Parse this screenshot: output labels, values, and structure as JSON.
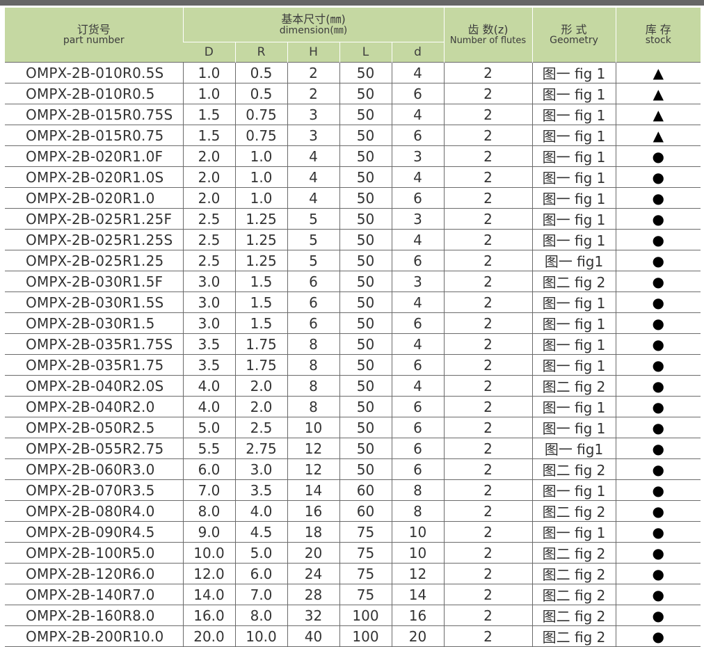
{
  "header": {
    "part_number_zh": "订货号",
    "part_number_en": "part number",
    "dimension_zh": "基本尺寸(㎜)",
    "dimension_en": "dimension(㎜)",
    "flutes_zh": "齿 数(z)",
    "flutes_en": "Number of flutes",
    "geometry_zh": "形 式",
    "geometry_en": "Geometry",
    "stock_zh": "库 存",
    "stock_en": "stock",
    "dim_columns": [
      "D",
      "R",
      "H",
      "L",
      "d"
    ]
  },
  "rows": [
    {
      "part": "OMPX-2B-010R0.5S",
      "D": "1.0",
      "R": "0.5",
      "H": "2",
      "L": "50",
      "d": "4",
      "z": "2",
      "geo": "图一 fig 1",
      "stock": "▲"
    },
    {
      "part": "OMPX-2B-010R0.5",
      "D": "1.0",
      "R": "0.5",
      "H": "2",
      "L": "50",
      "d": "6",
      "z": "2",
      "geo": "图一 fig 1",
      "stock": "▲"
    },
    {
      "part": "OMPX-2B-015R0.75S",
      "D": "1.5",
      "R": "0.75",
      "H": "3",
      "L": "50",
      "d": "4",
      "z": "2",
      "geo": "图一 fig 1",
      "stock": "▲"
    },
    {
      "part": "OMPX-2B-015R0.75",
      "D": "1.5",
      "R": "0.75",
      "H": "3",
      "L": "50",
      "d": "6",
      "z": "2",
      "geo": "图一 fig 1",
      "stock": "▲"
    },
    {
      "part": "OMPX-2B-020R1.0F",
      "D": "2.0",
      "R": "1.0",
      "H": "4",
      "L": "50",
      "d": "3",
      "z": "2",
      "geo": "图一 fig 1",
      "stock": "●"
    },
    {
      "part": "OMPX-2B-020R1.0S",
      "D": "2.0",
      "R": "1.0",
      "H": "4",
      "L": "50",
      "d": "4",
      "z": "2",
      "geo": "图一 fig 1",
      "stock": "●"
    },
    {
      "part": "OMPX-2B-020R1.0",
      "D": "2.0",
      "R": "1.0",
      "H": "4",
      "L": "50",
      "d": "6",
      "z": "2",
      "geo": "图一 fig 1",
      "stock": "●"
    },
    {
      "part": "OMPX-2B-025R1.25F",
      "D": "2.5",
      "R": "1.25",
      "H": "5",
      "L": "50",
      "d": "3",
      "z": "2",
      "geo": "图一 fig 1",
      "stock": "●"
    },
    {
      "part": "OMPX-2B-025R1.25S",
      "D": "2.5",
      "R": "1.25",
      "H": "5",
      "L": "50",
      "d": "4",
      "z": "2",
      "geo": "图一 fig 1",
      "stock": "●"
    },
    {
      "part": "OMPX-2B-025R1.25",
      "D": "2.5",
      "R": "1.25",
      "H": "5",
      "L": "50",
      "d": "6",
      "z": "2",
      "geo": "图一 fig1",
      "stock": "●"
    },
    {
      "part": "OMPX-2B-030R1.5F",
      "D": "3.0",
      "R": "1.5",
      "H": "6",
      "L": "50",
      "d": "3",
      "z": "2",
      "geo": "图二 fig 2",
      "stock": "●"
    },
    {
      "part": "OMPX-2B-030R1.5S",
      "D": "3.0",
      "R": "1.5",
      "H": "6",
      "L": "50",
      "d": "4",
      "z": "2",
      "geo": "图一 fig 1",
      "stock": "●"
    },
    {
      "part": "OMPX-2B-030R1.5",
      "D": "3.0",
      "R": "1.5",
      "H": "6",
      "L": "50",
      "d": "6",
      "z": "2",
      "geo": "图一 fig 1",
      "stock": "●"
    },
    {
      "part": "OMPX-2B-035R1.75S",
      "D": "3.5",
      "R": "1.75",
      "H": "8",
      "L": "50",
      "d": "4",
      "z": "2",
      "geo": "图一 fig 1",
      "stock": "●"
    },
    {
      "part": "OMPX-2B-035R1.75",
      "D": "3.5",
      "R": "1.75",
      "H": "8",
      "L": "50",
      "d": "6",
      "z": "2",
      "geo": "图一 fig 1",
      "stock": "●"
    },
    {
      "part": "OMPX-2B-040R2.0S",
      "D": "4.0",
      "R": "2.0",
      "H": "8",
      "L": "50",
      "d": "4",
      "z": "2",
      "geo": "图二 fig 2",
      "stock": "●"
    },
    {
      "part": "OMPX-2B-040R2.0",
      "D": "4.0",
      "R": "2.0",
      "H": "8",
      "L": "50",
      "d": "6",
      "z": "2",
      "geo": "图一 fig 1",
      "stock": "●"
    },
    {
      "part": "OMPX-2B-050R2.5",
      "D": "5.0",
      "R": "2.5",
      "H": "10",
      "L": "50",
      "d": "6",
      "z": "2",
      "geo": "图一 fig 1",
      "stock": "●"
    },
    {
      "part": "OMPX-2B-055R2.75",
      "D": "5.5",
      "R": "2.75",
      "H": "12",
      "L": "50",
      "d": "6",
      "z": "2",
      "geo": "图一 fig1",
      "stock": "●"
    },
    {
      "part": "OMPX-2B-060R3.0",
      "D": "6.0",
      "R": "3.0",
      "H": "12",
      "L": "50",
      "d": "6",
      "z": "2",
      "geo": "图二 fig 2",
      "stock": "●"
    },
    {
      "part": "OMPX-2B-070R3.5",
      "D": "7.0",
      "R": "3.5",
      "H": "14",
      "L": "60",
      "d": "8",
      "z": "2",
      "geo": "图一 fig 1",
      "stock": "●"
    },
    {
      "part": "OMPX-2B-080R4.0",
      "D": "8.0",
      "R": "4.0",
      "H": "16",
      "L": "60",
      "d": "8",
      "z": "2",
      "geo": "图二 fig 2",
      "stock": "●"
    },
    {
      "part": "OMPX-2B-090R4.5",
      "D": "9.0",
      "R": "4.5",
      "H": "18",
      "L": "75",
      "d": "10",
      "z": "2",
      "geo": "图一 fig 1",
      "stock": "●"
    },
    {
      "part": "OMPX-2B-100R5.0",
      "D": "10.0",
      "R": "5.0",
      "H": "20",
      "L": "75",
      "d": "10",
      "z": "2",
      "geo": "图二 fig 2",
      "stock": "●"
    },
    {
      "part": "OMPX-2B-120R6.0",
      "D": "12.0",
      "R": "6.0",
      "H": "24",
      "L": "75",
      "d": "12",
      "z": "2",
      "geo": "图二 fig 2",
      "stock": "●"
    },
    {
      "part": "OMPX-2B-140R7.0",
      "D": "14.0",
      "R": "7.0",
      "H": "28",
      "L": "75",
      "d": "14",
      "z": "2",
      "geo": "图二 fig 2",
      "stock": "●"
    },
    {
      "part": "OMPX-2B-160R8.0",
      "D": "16.0",
      "R": "8.0",
      "H": "32",
      "L": "100",
      "d": "16",
      "z": "2",
      "geo": "图二 fig 2",
      "stock": "●"
    },
    {
      "part": "OMPX-2B-200R10.0",
      "D": "20.0",
      "R": "10.0",
      "H": "40",
      "L": "100",
      "d": "20",
      "z": "2",
      "geo": "图二 fig 2",
      "stock": "●"
    }
  ]
}
